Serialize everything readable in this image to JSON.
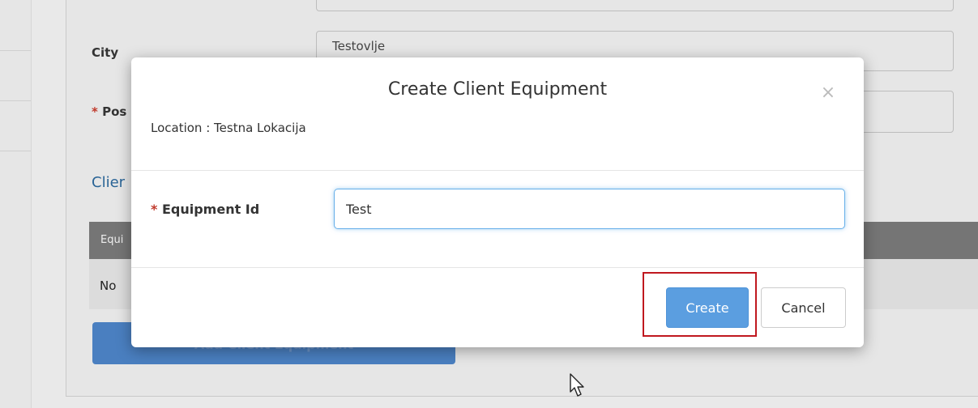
{
  "background": {
    "city_label": "City",
    "city_value": "Testovlje",
    "postal_label_prefix": "*",
    "postal_label": "Pos",
    "section_title": "Clier",
    "table_header": "Equi",
    "table_empty": "No",
    "add_button": "Add Client Equipment"
  },
  "modal": {
    "title": "Create Client Equipment",
    "close_label": "×",
    "location": "Location : Testna Lokacija",
    "field_required_mark": "*",
    "field_label": "Equipment Id",
    "field_value": "Test",
    "create_label": "Create",
    "cancel_label": "Cancel"
  },
  "colors": {
    "primary": "#5b9ee0",
    "highlight": "#c0181f",
    "required": "#c0392b"
  }
}
